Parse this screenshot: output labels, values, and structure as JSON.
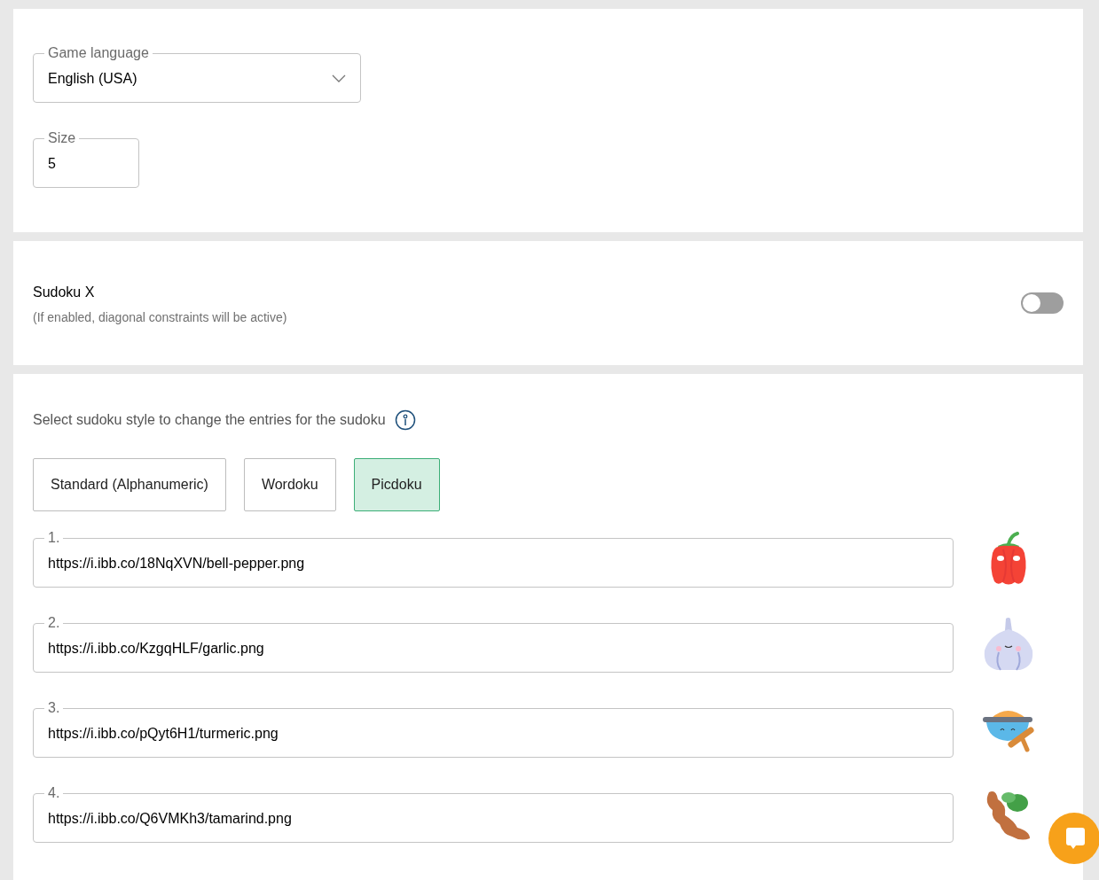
{
  "language_field": {
    "label": "Game language",
    "value": "English (USA)"
  },
  "size_field": {
    "label": "Size",
    "value": "5"
  },
  "sudoku_x": {
    "title": "Sudoku X",
    "description": "(If enabled, diagonal constraints will be active)",
    "on": false
  },
  "style_section": {
    "prompt": "Select sudoku style to change the entries for the sudoku",
    "styles": [
      {
        "label": "Standard (Alphanumeric)",
        "selected": false
      },
      {
        "label": "Wordoku",
        "selected": false
      },
      {
        "label": "Picdoku",
        "selected": true
      }
    ],
    "entries": [
      {
        "label": "1.",
        "value": "https://i.ibb.co/18NqXVN/bell-pepper.png"
      },
      {
        "label": "2.",
        "value": "https://i.ibb.co/KzgqHLF/garlic.png"
      },
      {
        "label": "3.",
        "value": "https://i.ibb.co/pQyt6H1/turmeric.png"
      },
      {
        "label": "4.",
        "value": "https://i.ibb.co/Q6VMKh3/tamarind.png"
      }
    ]
  }
}
